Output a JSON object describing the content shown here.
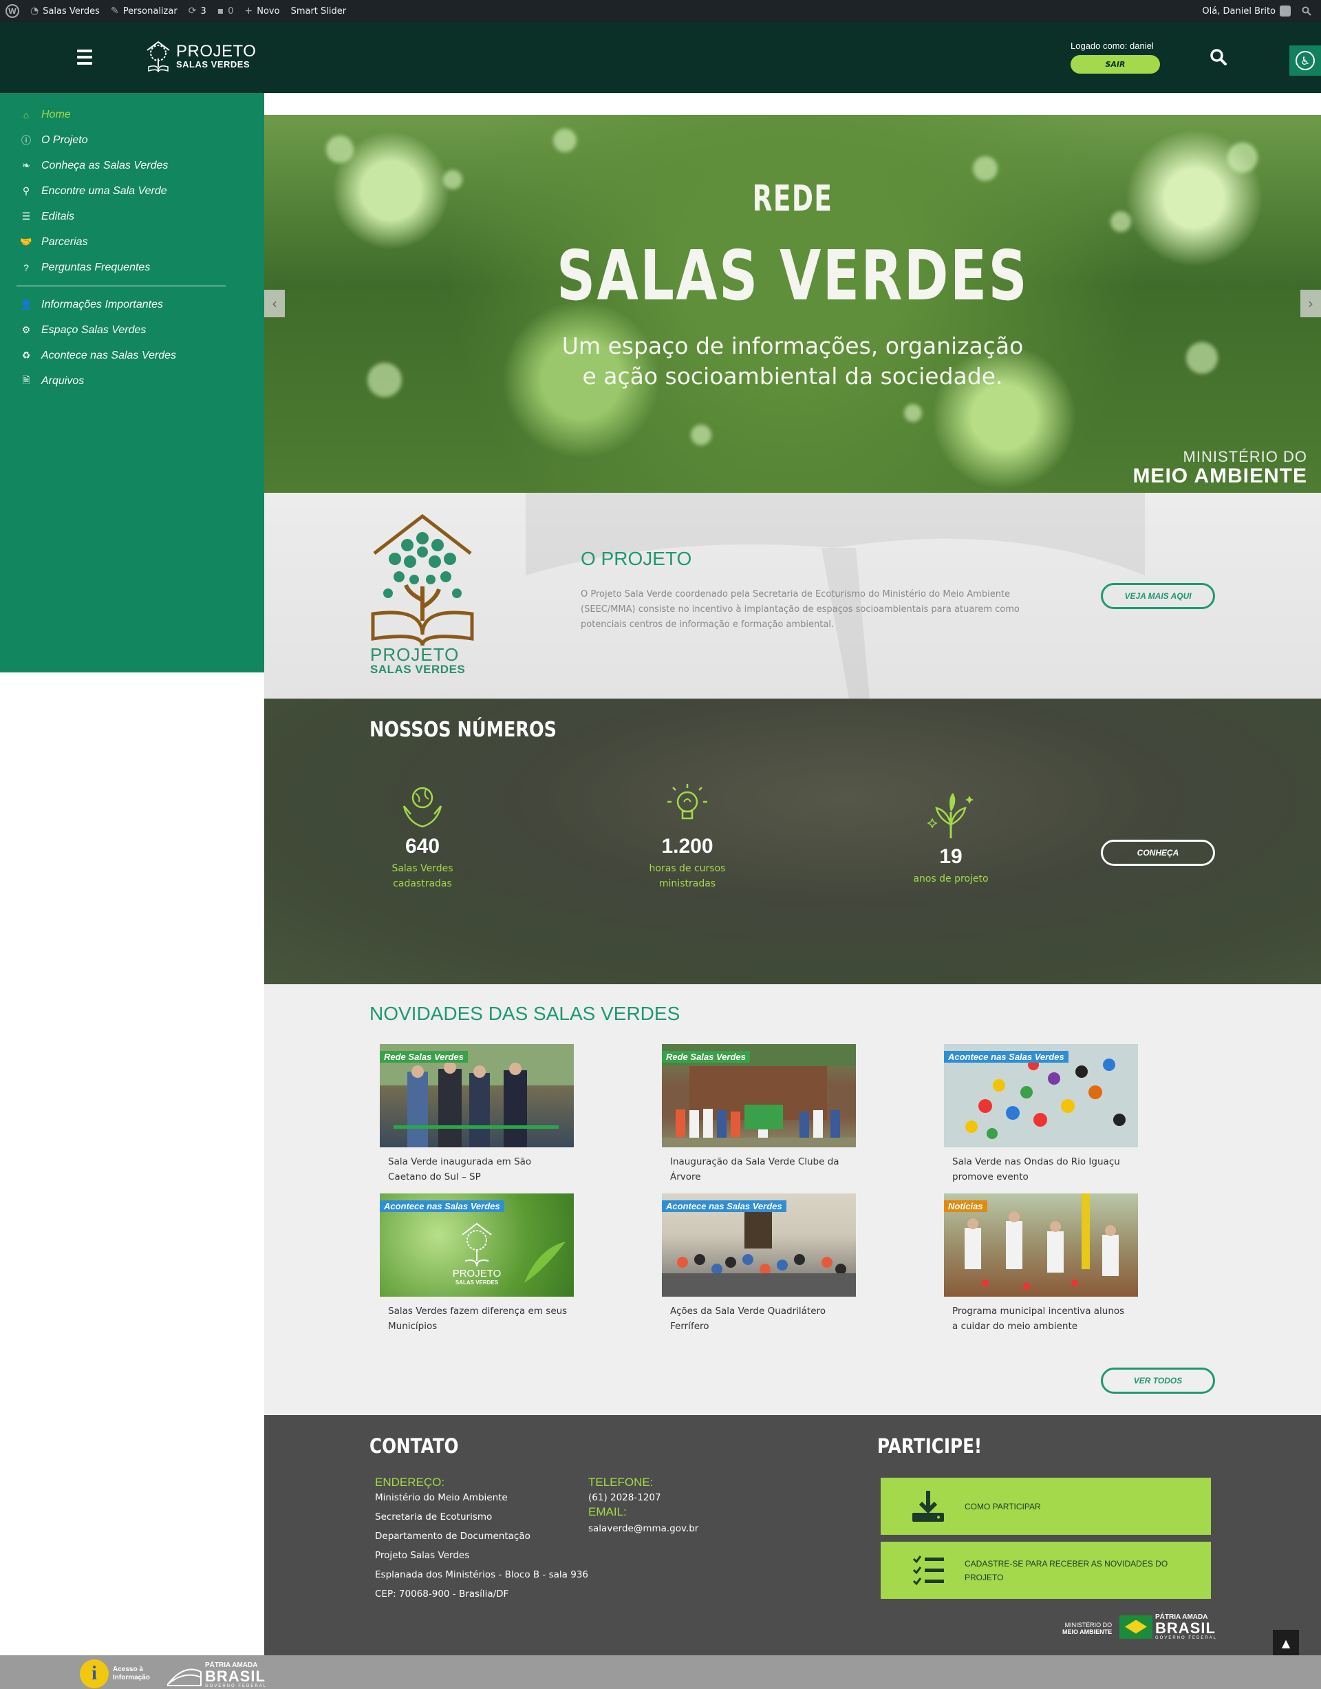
{
  "adminbar": {
    "site": "Salas Verdes",
    "customize": "Personalizar",
    "updates": "3",
    "comments": "0",
    "new": "Novo",
    "slider": "Smart Slider",
    "greeting": "Olá, Daniel Brito"
  },
  "header": {
    "logo_line1": "PROJETO",
    "logo_line2": "SALAS VERDES",
    "logged_as": "Logado como: daniel",
    "logout": "SAIR"
  },
  "sidebar": {
    "items": [
      {
        "label": "Home",
        "icon": "home-icon"
      },
      {
        "label": "O Projeto",
        "icon": "info-icon"
      },
      {
        "label": "Conheça as Salas Verdes",
        "icon": "leaf-icon"
      },
      {
        "label": "Encontre uma Sala Verde",
        "icon": "search-icon"
      },
      {
        "label": "Editais",
        "icon": "list-icon"
      },
      {
        "label": "Parcerias",
        "icon": "handshake-icon"
      },
      {
        "label": "Perguntas Frequentes",
        "icon": "question-icon"
      }
    ],
    "items2": [
      {
        "label": "Informações Importantes",
        "icon": "user-icon"
      },
      {
        "label": "Espaço Salas Verdes",
        "icon": "gear-icon"
      },
      {
        "label": "Acontece nas Salas Verdes",
        "icon": "recycle-icon"
      },
      {
        "label": "Arquivos",
        "icon": "file-icon"
      }
    ]
  },
  "hero": {
    "kicker": "REDE",
    "title": "SALAS VERDES",
    "sub1": "Um espaço de informações, organização",
    "sub2": "e ação socioambiental da sociedade.",
    "ministry1": "MINISTÉRIO DO",
    "ministry2": "MEIO AMBIENTE"
  },
  "projeto": {
    "logo_line1": "PROJETO",
    "logo_line2": "SALAS VERDES",
    "title": "O PROJETO",
    "text": "O Projeto Sala Verde coordenado pela Secretaria de Ecoturismo do Ministério do Meio Ambiente (SEEC/MMA) consiste no incentivo à implantação de espaços socioambientais para atuarem como potenciais centros de informação e formação ambiental.",
    "button": "VEJA MAIS AQUI"
  },
  "numeros": {
    "title": "NOSSOS NÚMEROS",
    "items": [
      {
        "value": "640",
        "label1": "Salas Verdes",
        "label2": "cadastradas"
      },
      {
        "value": "1.200",
        "label1": "horas de cursos",
        "label2": "ministradas"
      },
      {
        "value": "19",
        "label1": "anos de projeto",
        "label2": ""
      }
    ],
    "button": "CONHEÇA"
  },
  "novidades": {
    "title": "NOVIDADES DAS SALAS VERDES",
    "cards": [
      {
        "badge": "Rede Salas Verdes",
        "caption": "Sala Verde inaugurada em São Caetano do Sul – SP"
      },
      {
        "badge": "Rede Salas Verdes",
        "caption": "Inauguração da Sala Verde Clube da Árvore"
      },
      {
        "badge": "Acontece nas Salas Verdes",
        "caption": "Sala Verde nas Ondas do Rio Iguaçu promove evento"
      },
      {
        "badge": "Acontece nas Salas Verdes",
        "caption": "Salas Verdes fazem diferença em seus Municípios"
      },
      {
        "badge": "Acontece nas Salas Verdes",
        "caption": "Ações da Sala Verde Quadrilátero Ferrífero"
      },
      {
        "badge": "Notícias",
        "caption": "Programa municipal incentiva alunos a cuidar do meio ambiente"
      }
    ],
    "thumb_logo1": "PROJETO",
    "thumb_logo2": "SALAS VERDES",
    "button": "VER TODOS"
  },
  "contato": {
    "title": "CONTATO",
    "endereco_label": "ENDEREÇO:",
    "endereco": [
      "Ministério do Meio Ambiente",
      "Secretaria de Ecoturismo",
      "Departamento de Documentação",
      "Projeto Salas Verdes",
      "Esplanada dos Ministérios - Bloco B - sala 936",
      "CEP: 70068-900 - Brasília/DF"
    ],
    "telefone_label": "TELEFONE:",
    "telefone": "(61) 2028-1207",
    "email_label": "EMAIL:",
    "email": "salaverde@mma.gov.br"
  },
  "participe": {
    "title": "PARTICIPE!",
    "btn1": "COMO PARTICIPAR",
    "btn2": "CADASTRE-SE PARA RECEBER AS NOVIDADES DO PROJETO",
    "mma1": "MINISTÉRIO DO",
    "mma2": "MEIO AMBIENTE",
    "patria1": "PÁTRIA AMADA",
    "patria2": "BRASIL",
    "patria3": "GOVERNO FEDERAL"
  },
  "bottombar": {
    "acesso1": "Acesso à",
    "acesso2": "Informação",
    "patria1": "PÁTRIA AMADA",
    "patria2": "BRASIL",
    "patria3": "GOVERNO FEDERAL"
  },
  "colors": {
    "header": "#0a3027",
    "sidebar": "#12865e",
    "accent_lime": "#a3d94a",
    "accent_green": "#1d9973",
    "footer": "#4d4d4d"
  }
}
